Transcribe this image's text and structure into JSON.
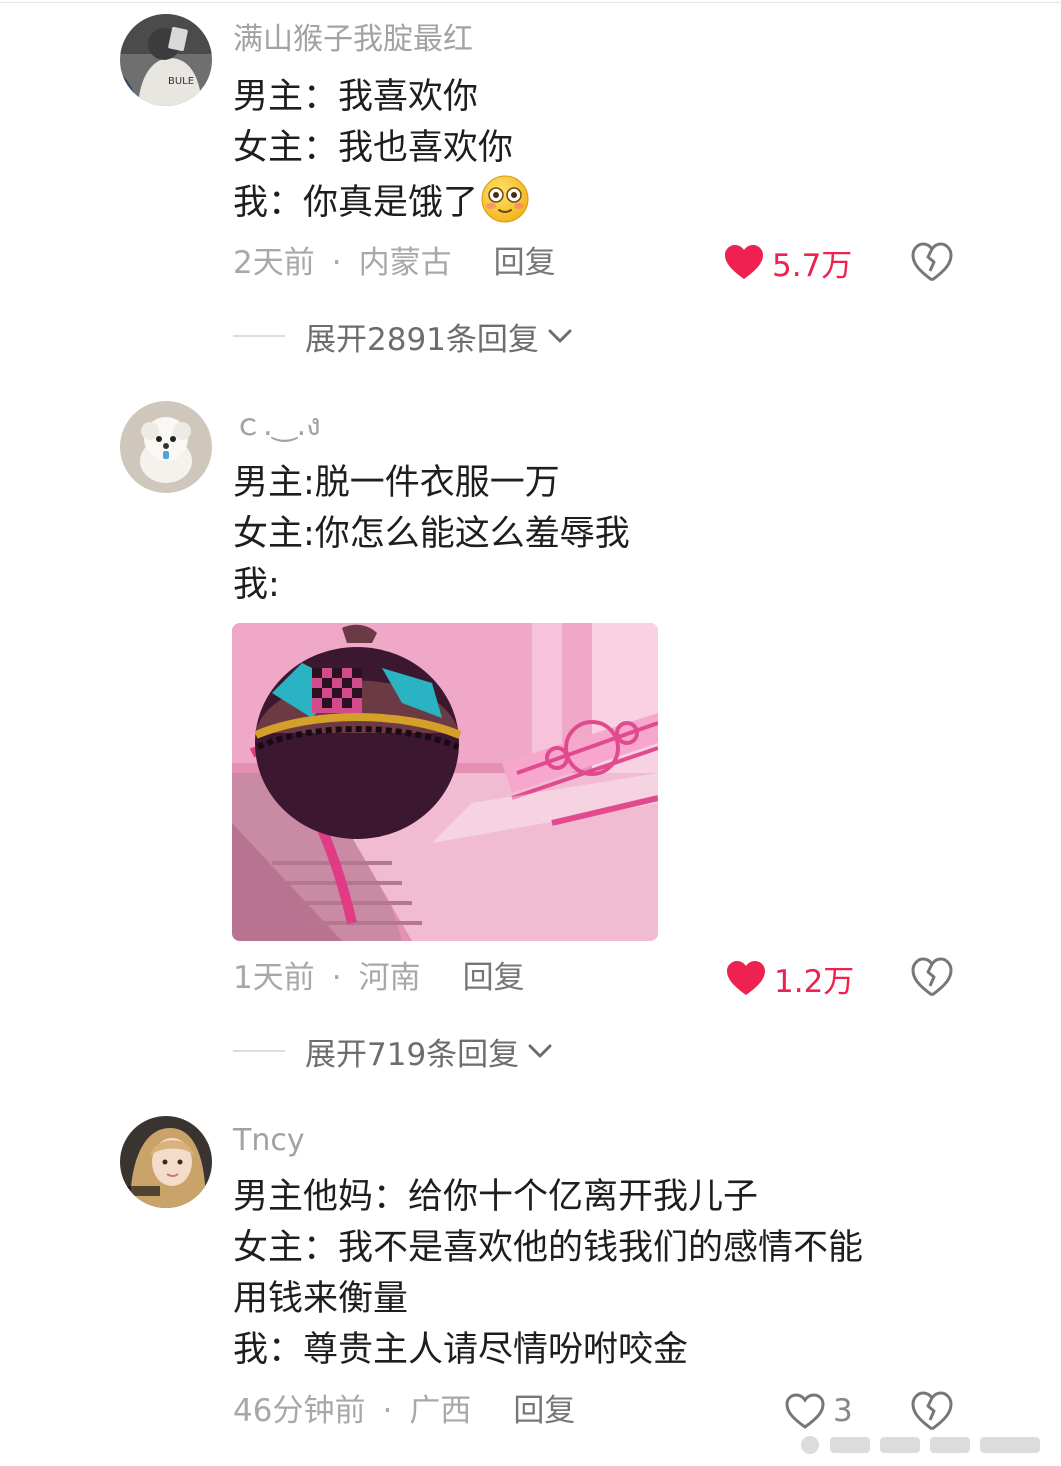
{
  "comments": [
    {
      "username": "满山猴子我腚最红",
      "lines": [
        "男主：我喜欢你",
        "女主：我也喜欢你",
        "我：你真是饿了"
      ],
      "emoji_icon": "flushed-face-emoji-icon",
      "time": "2天前",
      "separator": "·",
      "location": "内蒙古",
      "reply_label": "回复",
      "likes": "5.7万",
      "liked": true,
      "expand_label": "展开2891条回复"
    },
    {
      "username": "ｃ.‿.ง",
      "lines": [
        "男主:脱一件衣服一万",
        "女主:你怎么能这么羞辱我",
        "我:"
      ],
      "image_icon": "animated-pink-mansion-image",
      "time": "1天前",
      "separator": "·",
      "location": "河南",
      "reply_label": "回复",
      "likes": "1.2万",
      "liked": true,
      "expand_label": "展开719条回复"
    },
    {
      "username": "Tncy",
      "lines": [
        "男主他妈：给你十个亿离开我儿子",
        "女主：我不是喜欢他的钱我们的感情不能",
        "用钱来衡量",
        "我：尊贵主人请尽情吩咐咬金"
      ],
      "time": "46分钟前",
      "separator": "·",
      "location": "广西",
      "reply_label": "回复",
      "likes": "3",
      "liked": false
    }
  ],
  "colors": {
    "like_red": "#ee2150",
    "text": "#1e1e1e",
    "muted": "#a8a8a8"
  },
  "icons": {
    "like": "heart-icon",
    "dislike": "broken-heart-icon",
    "expand": "chevron-down-icon"
  }
}
